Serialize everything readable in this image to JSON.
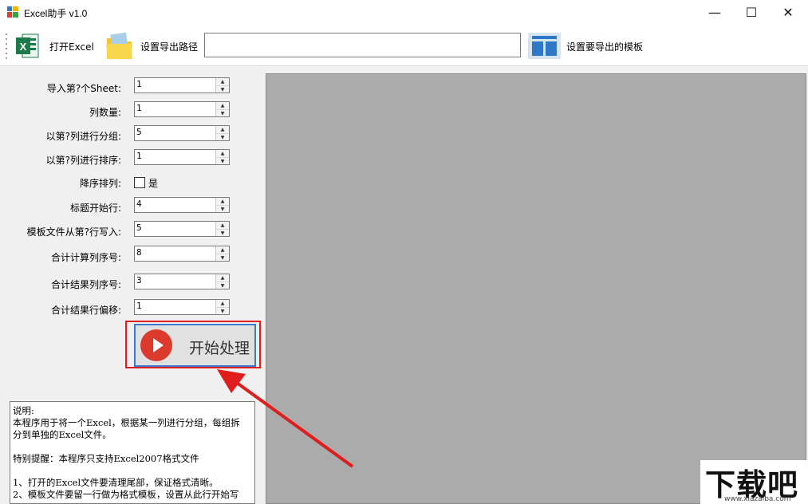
{
  "window": {
    "title": "Excel助手 v1.0",
    "minimize_glyph": "—",
    "maximize_glyph": "☐",
    "close_glyph": "✕"
  },
  "toolbar": {
    "open_excel_label": "打开Excel",
    "set_export_path_label": "设置导出路径",
    "export_path_value": "",
    "set_template_label": "设置要导出的模板",
    "icons": [
      "excel-icon",
      "folder-icon",
      "template-layout-icon"
    ]
  },
  "form": {
    "rows": [
      {
        "label": "导入第?个Sheet:",
        "value": "1"
      },
      {
        "label": "列数量:",
        "value": "1"
      },
      {
        "label": "以第?列进行分组:",
        "value": "5"
      },
      {
        "label": "以第?列进行排序:",
        "value": "1"
      },
      {
        "label": "标题开始行:",
        "value": "4"
      },
      {
        "label": "模板文件从第?行写入:",
        "value": "5"
      },
      {
        "label": "合计计算列序号:",
        "value": "8"
      },
      {
        "label": "合计结果列序号:",
        "value": "3"
      },
      {
        "label": "合计结果行偏移:",
        "value": "1"
      }
    ],
    "descending": {
      "label": "降序排列:",
      "option_label": "是",
      "checked": false
    }
  },
  "start_button": {
    "label": "开始处理"
  },
  "description": {
    "lines": [
      "说明:",
      "本程序用于将一个Excel，根据某一列进行分组，每组拆",
      "分到单独的Excel文件。",
      "",
      "特别提醒：本程序只支持Excel2007格式文件",
      "",
      "1、打开的Excel文件要清理尾部，保证格式清晰。",
      "2、模板文件要留一行做为格式模板，设置从此行开始写"
    ]
  },
  "watermark": {
    "big": "下载吧",
    "small": "www.xiazaiba.com"
  },
  "colors": {
    "highlight": "#e01c1c",
    "play": "#dc3a2c",
    "preview_bg": "#ababab",
    "excel_green": "#1f7a4a",
    "template_blue": "#2e78c8"
  }
}
